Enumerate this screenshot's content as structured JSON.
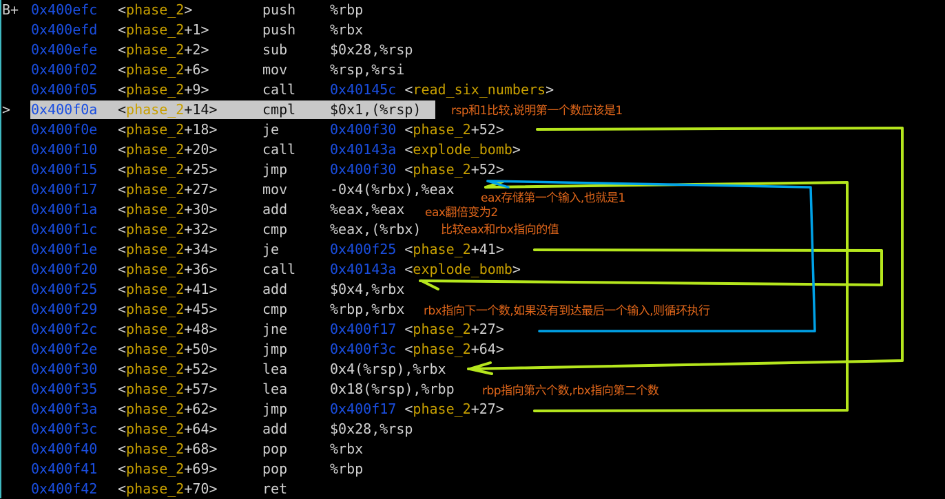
{
  "colors": {
    "address": "#1a4ee0",
    "symbol": "#c8a000",
    "annotation": "#e0661a",
    "arrow_green": "#b5e61d",
    "arrow_blue": "#00a2e8",
    "highlight": "#c8c8c8"
  },
  "rows": [
    {
      "mark": "B+",
      "addr": "0x400efc",
      "sym": "phase_2",
      "off": "",
      "mn": "push",
      "ops": "%rbp"
    },
    {
      "mark": "",
      "addr": "0x400efd",
      "sym": "phase_2",
      "off": "+1",
      "mn": "push",
      "ops": "%rbx"
    },
    {
      "mark": "",
      "addr": "0x400efe",
      "sym": "phase_2",
      "off": "+2",
      "mn": "sub",
      "ops": "$0x28,%rsp"
    },
    {
      "mark": "",
      "addr": "0x400f02",
      "sym": "phase_2",
      "off": "+6",
      "mn": "mov",
      "ops": "%rsp,%rsi"
    },
    {
      "mark": "",
      "addr": "0x400f05",
      "sym": "phase_2",
      "off": "+9",
      "mn": "call",
      "ops": "",
      "taddr": "0x40145c",
      "tsym": "read_six_numbers",
      "toff": ""
    },
    {
      "mark": ">",
      "addr": "0x400f0a",
      "sym": "phase_2",
      "off": "+14",
      "mn": "cmpl",
      "ops": "$0x1,(%rsp)",
      "current": true
    },
    {
      "mark": "",
      "addr": "0x400f0e",
      "sym": "phase_2",
      "off": "+18",
      "mn": "je",
      "ops": "",
      "taddr": "0x400f30",
      "tsym": "phase_2",
      "toff": "+52"
    },
    {
      "mark": "",
      "addr": "0x400f10",
      "sym": "phase_2",
      "off": "+20",
      "mn": "call",
      "ops": "",
      "taddr": "0x40143a",
      "tsym": "explode_bomb",
      "toff": ""
    },
    {
      "mark": "",
      "addr": "0x400f15",
      "sym": "phase_2",
      "off": "+25",
      "mn": "jmp",
      "ops": "",
      "taddr": "0x400f30",
      "tsym": "phase_2",
      "toff": "+52"
    },
    {
      "mark": "",
      "addr": "0x400f17",
      "sym": "phase_2",
      "off": "+27",
      "mn": "mov",
      "ops": "-0x4(%rbx),%eax"
    },
    {
      "mark": "",
      "addr": "0x400f1a",
      "sym": "phase_2",
      "off": "+30",
      "mn": "add",
      "ops": "%eax,%eax"
    },
    {
      "mark": "",
      "addr": "0x400f1c",
      "sym": "phase_2",
      "off": "+32",
      "mn": "cmp",
      "ops": "%eax,(%rbx)"
    },
    {
      "mark": "",
      "addr": "0x400f1e",
      "sym": "phase_2",
      "off": "+34",
      "mn": "je",
      "ops": "",
      "taddr": "0x400f25",
      "tsym": "phase_2",
      "toff": "+41"
    },
    {
      "mark": "",
      "addr": "0x400f20",
      "sym": "phase_2",
      "off": "+36",
      "mn": "call",
      "ops": "",
      "taddr": "0x40143a",
      "tsym": "explode_bomb",
      "toff": ""
    },
    {
      "mark": "",
      "addr": "0x400f25",
      "sym": "phase_2",
      "off": "+41",
      "mn": "add",
      "ops": "$0x4,%rbx"
    },
    {
      "mark": "",
      "addr": "0x400f29",
      "sym": "phase_2",
      "off": "+45",
      "mn": "cmp",
      "ops": "%rbp,%rbx"
    },
    {
      "mark": "",
      "addr": "0x400f2c",
      "sym": "phase_2",
      "off": "+48",
      "mn": "jne",
      "ops": "",
      "taddr": "0x400f17",
      "tsym": "phase_2",
      "toff": "+27"
    },
    {
      "mark": "",
      "addr": "0x400f2e",
      "sym": "phase_2",
      "off": "+50",
      "mn": "jmp",
      "ops": "",
      "taddr": "0x400f3c",
      "tsym": "phase_2",
      "toff": "+64"
    },
    {
      "mark": "",
      "addr": "0x400f30",
      "sym": "phase_2",
      "off": "+52",
      "mn": "lea",
      "ops": "0x4(%rsp),%rbx"
    },
    {
      "mark": "",
      "addr": "0x400f35",
      "sym": "phase_2",
      "off": "+57",
      "mn": "lea",
      "ops": "0x18(%rsp),%rbp"
    },
    {
      "mark": "",
      "addr": "0x400f3a",
      "sym": "phase_2",
      "off": "+62",
      "mn": "jmp",
      "ops": "",
      "taddr": "0x400f17",
      "tsym": "phase_2",
      "toff": "+27"
    },
    {
      "mark": "",
      "addr": "0x400f3c",
      "sym": "phase_2",
      "off": "+64",
      "mn": "add",
      "ops": "$0x28,%rsp"
    },
    {
      "mark": "",
      "addr": "0x400f40",
      "sym": "phase_2",
      "off": "+68",
      "mn": "pop",
      "ops": "%rbx"
    },
    {
      "mark": "",
      "addr": "0x400f41",
      "sym": "phase_2",
      "off": "+69",
      "mn": "pop",
      "ops": "%rbp"
    },
    {
      "mark": "",
      "addr": "0x400f42",
      "sym": "phase_2",
      "off": "+70",
      "mn": "ret",
      "ops": ""
    }
  ],
  "annotations": {
    "a1": "rsp和1比较,说明第一个数应该是1",
    "a2": "eax存储第一个输入,也就是1",
    "a3": "eax翻倍变为2",
    "a4": "比较eax和rbx指向的值",
    "a5": "rbx指向下一个数,如果没有到达最后一个输入,则循环执行",
    "a6": "rbp指向第六个数,rbx指向第二个数"
  }
}
